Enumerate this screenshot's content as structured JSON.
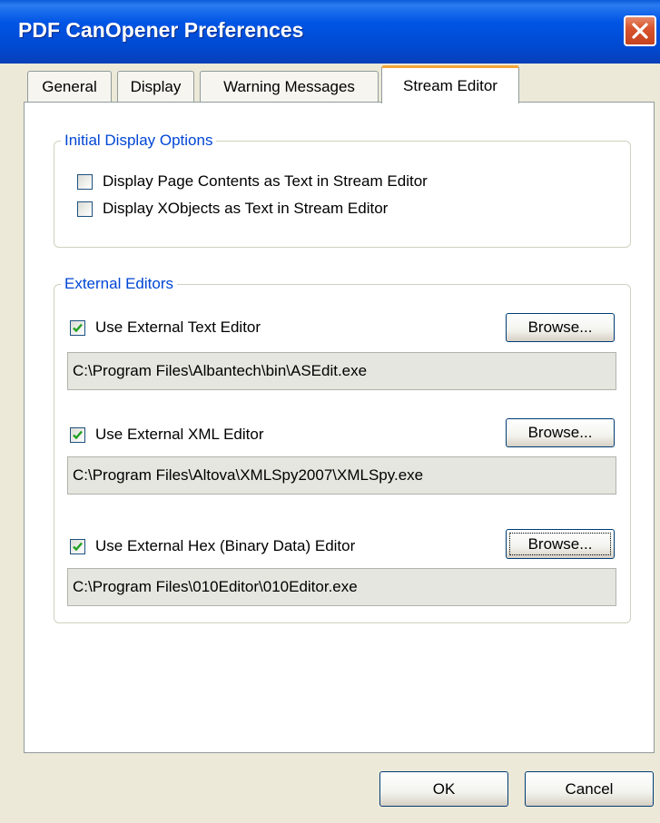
{
  "window": {
    "title": "PDF CanOpener Preferences"
  },
  "tabs": [
    {
      "label": "General"
    },
    {
      "label": "Display"
    },
    {
      "label": "Warning Messages"
    },
    {
      "label": "Stream Editor"
    }
  ],
  "initial_display": {
    "title": "Initial Display Options",
    "options": [
      {
        "label": "Display Page Contents as Text in Stream Editor",
        "checked": false
      },
      {
        "label": "Display XObjects as Text in Stream Editor",
        "checked": false
      }
    ]
  },
  "external_editors": {
    "title": "External Editors",
    "editors": [
      {
        "label": "Use External Text Editor",
        "checked": true,
        "path": "C:\\Program Files\\Albantech\\bin\\ASEdit.exe",
        "browse_label": "Browse..."
      },
      {
        "label": "Use External XML Editor",
        "checked": true,
        "path": "C:\\Program Files\\Altova\\XMLSpy2007\\XMLSpy.exe",
        "browse_label": "Browse..."
      },
      {
        "label": "Use External Hex (Binary Data) Editor",
        "checked": true,
        "path": "C:\\Program Files\\010Editor\\010Editor.exe",
        "browse_label": "Browse..."
      }
    ]
  },
  "footer": {
    "ok_label": "OK",
    "cancel_label": "Cancel"
  },
  "colors": {
    "title_bar": "#0054e3",
    "group_title": "#0046d5",
    "tab_highlight": "#f0a53a",
    "check": "#21a121"
  }
}
